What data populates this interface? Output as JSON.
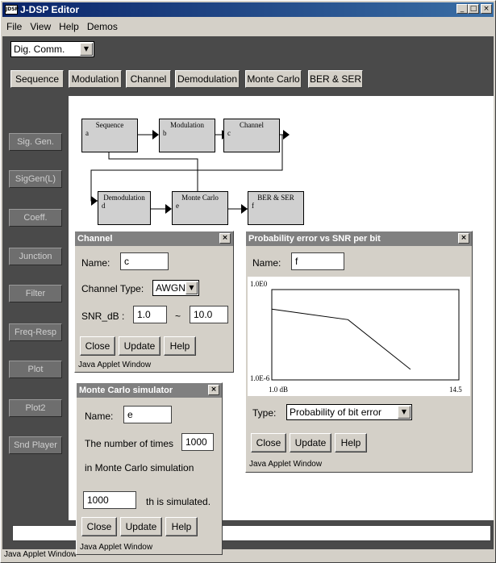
{
  "window": {
    "title": "J-DSP Editor",
    "icon_text": "JDSP",
    "controls": {
      "minimize": "_",
      "maximize": "□",
      "close": "×"
    }
  },
  "menu": [
    "File",
    "View",
    "Help",
    "Demos"
  ],
  "category_select": {
    "value": "Dig. Comm."
  },
  "toolbar": [
    "Sequence",
    "Modulation",
    "Channel",
    "Demodulation",
    "Monte Carlo",
    "BER & SER"
  ],
  "sidebar": [
    "Sig. Gen.",
    "SigGen(L)",
    "Coeff.",
    "Junction",
    "Filter",
    "Freq-Resp",
    "Plot",
    "Plot2",
    "Snd Player"
  ],
  "blocks": [
    {
      "name": "Sequence",
      "sub": "a"
    },
    {
      "name": "Modulation",
      "sub": "b"
    },
    {
      "name": "Channel",
      "sub": "c"
    },
    {
      "name": "Demodulation",
      "sub": "d"
    },
    {
      "name": "Monte Carlo",
      "sub": "e"
    },
    {
      "name": "BER & SER",
      "sub": "f"
    }
  ],
  "channel_dialog": {
    "title": "Channel",
    "name_label": "Name:",
    "name_value": "c",
    "type_label": "Channel Type:",
    "type_value": "AWGN",
    "snr_label": "SNR_dB :",
    "snr_from": "1.0",
    "snr_sep": "~",
    "snr_to": "10.0",
    "buttons": [
      "Close",
      "Update",
      "Help"
    ],
    "footer": "Java Applet Window"
  },
  "monte_dialog": {
    "title": "Monte Carlo simulator",
    "name_label": "Name:",
    "name_value": "e",
    "times_label": "The number of times",
    "times_value": "1000",
    "times_label2": "in Monte Carlo simulation",
    "simulated_value": "1000",
    "simulated_label": "th is simulated.",
    "buttons": [
      "Close",
      "Update",
      "Help"
    ],
    "footer": "Java Applet Window"
  },
  "prob_dialog": {
    "title": "Probability error vs SNR per bit",
    "name_label": "Name:",
    "name_value": "f",
    "type_label": "Type:",
    "type_value": "Probability of bit error",
    "buttons": [
      "Close",
      "Update",
      "Help"
    ],
    "footer": "Java Applet Window"
  },
  "chart_data": {
    "type": "line",
    "xlabel": "",
    "ylabel": "",
    "x_tick_labels": [
      "1.0 dB",
      "14.5"
    ],
    "y_tick_labels": [
      "1.0E0",
      "1.0E-6"
    ],
    "xlim": [
      1.0,
      14.5
    ],
    "ylim_log10": [
      -6,
      0
    ],
    "log_y": true,
    "grid": false,
    "series": [
      {
        "x": [
          1.0,
          6.5,
          11.0
        ],
        "y_log10": [
          -1.3,
          -2.0,
          -5.3
        ]
      }
    ]
  },
  "status": {
    "footer": "Java Applet Window"
  }
}
